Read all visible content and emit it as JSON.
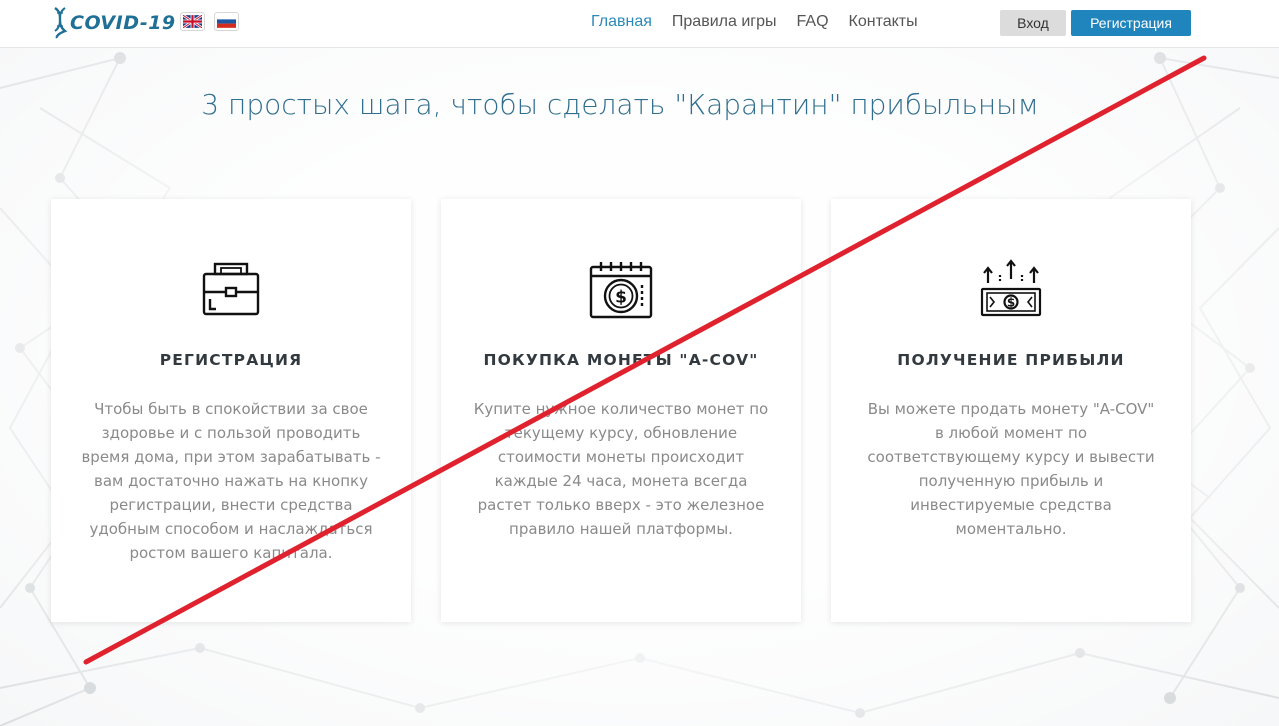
{
  "header": {
    "logo_text": "COVID-19",
    "flags": [
      {
        "lang": "en",
        "icon": "uk-flag-icon"
      },
      {
        "lang": "ru",
        "icon": "russia-flag-icon"
      }
    ],
    "nav": [
      {
        "label": "Главная",
        "active": true
      },
      {
        "label": "Правила игры",
        "active": false
      },
      {
        "label": "FAQ",
        "active": false
      },
      {
        "label": "Контакты",
        "active": false
      }
    ],
    "login_label": "Вход",
    "register_label": "Регистрация"
  },
  "main": {
    "headline": "3 простых шага, чтобы сделать \"Карантин\" прибыльным",
    "steps": [
      {
        "icon": "briefcase-icon",
        "title": "РЕГИСТРАЦИЯ",
        "description": "Чтобы быть в спокойствии за свое здоровье и с пользой проводить время дома, при этом зарабатывать - вам достаточно нажать на кнопку регистрации, внести средства удобным способом и наслаждаться ростом вашего капитала."
      },
      {
        "icon": "dollar-coin-calendar-icon",
        "title": "ПОКУПКА МОНЕТЫ \"A-COV\"",
        "description": "Купите нужное количество монет по текущему курсу, обновление стоимости монеты происходит каждые 24 часа, монета всегда растет только вверх - это железное правило нашей платформы."
      },
      {
        "icon": "money-growth-icon",
        "title": "ПОЛУЧЕНИЕ ПРИБЫЛИ",
        "description": "Вы можете продать монету \"A-COV\" в любой момент по соответствующему курсу и вывести полученную прибыль и инвестируемые средства моментально."
      }
    ]
  },
  "colors": {
    "accent": "#2185bd",
    "nav_active": "#2b8ab8",
    "headline": "#2f6e8e",
    "overlay_strike": "#e0222e"
  }
}
